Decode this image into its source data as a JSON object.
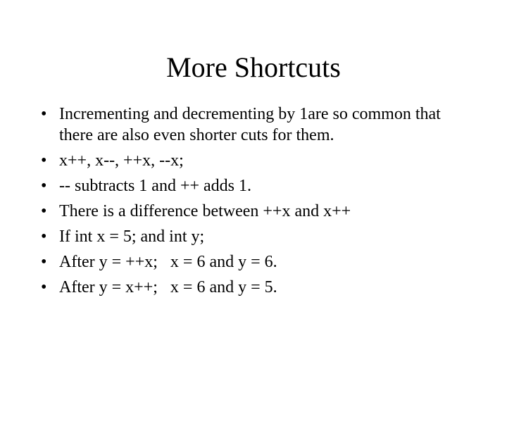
{
  "title": "More Shortcuts",
  "bullets": [
    "Incrementing and decrementing by 1are so common that there are also even shorter cuts for them.",
    "x++, x--, ++x, --x;",
    "-- subtracts 1 and ++ adds 1.",
    "There is a difference between ++x and x++",
    "If int x = 5; and int y;",
    "After y = ++x;   x = 6 and y = 6.",
    "After y = x++;   x = 6 and y = 5."
  ]
}
